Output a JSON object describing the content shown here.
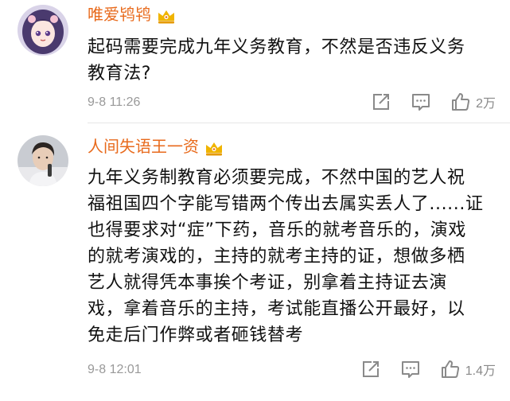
{
  "colors": {
    "username": "#e86a1c",
    "text": "#111111",
    "meta": "#999999",
    "icon": "#8a8a8a",
    "badge": "#f0b400"
  },
  "comments": [
    {
      "username": "唯爱鸨鸨",
      "badge_icon": "crown-badge-icon",
      "avatar": "anime-girl-avatar",
      "content": "起码需要完成九年义务教育，不然是否违反义务\n教育法?",
      "time": "9-8 11:26",
      "likes": "2万"
    },
    {
      "username": "人间失语王一资",
      "badge_icon": "crown-badge-icon",
      "avatar": "man-portrait-avatar",
      "content": "九年义务制教育必须要完成，不然中国的艺人祝\n福祖国四个字能写错两个传出去属实丢人了......证\n也得要求对“症”下药，音乐的就考音乐的，演戏\n的就考演戏的，主持的就考主持的证，想做多栖\n艺人就得凭本事挨个考证，别拿着主持证去演\n戏，拿着音乐的主持，考试能直播公开最好，以\n免走后门作弊或者砸钱替考",
      "time": "9-8 12:01",
      "likes": "1.4万"
    }
  ]
}
